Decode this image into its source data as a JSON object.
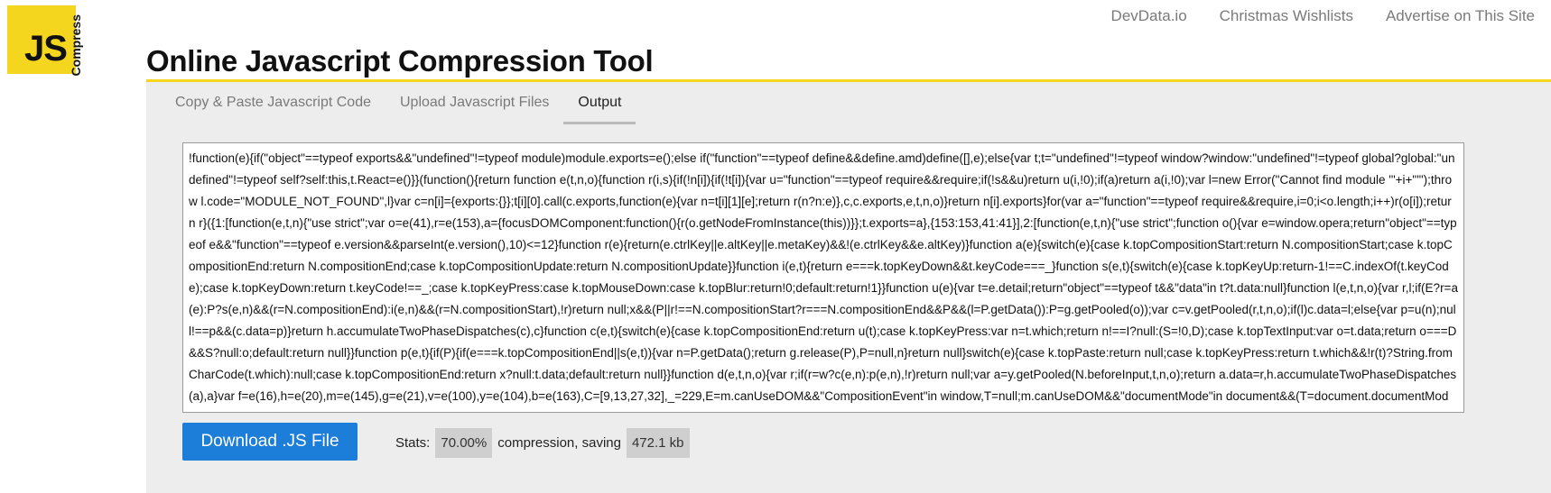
{
  "logo": {
    "main": "JS",
    "side": "Compress"
  },
  "topnav": {
    "links": [
      "DevData.io",
      "Christmas Wishlists",
      "Advertise on This Site"
    ]
  },
  "title": "Online Javascript Compression Tool",
  "tabs": [
    {
      "label": "Copy & Paste Javascript Code",
      "active": false
    },
    {
      "label": "Upload Javascript Files",
      "active": false
    },
    {
      "label": "Output",
      "active": true
    }
  ],
  "output": {
    "code": "!function(e){if(\"object\"==typeof exports&&\"undefined\"!=typeof module)module.exports=e();else if(\"function\"==typeof define&&define.amd)define([],e);else{var t;t=\"undefined\"!=typeof window?window:\"undefined\"!=typeof global?global:\"undefined\"!=typeof self?self:this,t.React=e()}}(function(){return function e(t,n,o){function r(i,s){if(!n[i]){if(!t[i]){var u=\"function\"==typeof require&&require;if(!s&&u)return u(i,!0);if(a)return a(i,!0);var l=new Error(\"Cannot find module '\"+i+\"'\");throw l.code=\"MODULE_NOT_FOUND\",l}var c=n[i]={exports:{}};t[i][0].call(c.exports,function(e){var n=t[i][1][e];return r(n?n:e)},c,c.exports,e,t,n,o)}return n[i].exports}for(var a=\"function\"==typeof require&&require,i=0;i<o.length;i++)r(o[i]);return r}({1:[function(e,t,n){\"use strict\";var o=e(41),r=e(153),a={focusDOMComponent:function(){r(o.getNodeFromInstance(this))}};t.exports=a},{153:153,41:41}],2:[function(e,t,n){\"use strict\";function o(){var e=window.opera;return\"object\"==typeof e&&\"function\"==typeof e.version&&parseInt(e.version(),10)<=12}function r(e){return(e.ctrlKey||e.altKey||e.metaKey)&&!(e.ctrlKey&&e.altKey)}function a(e){switch(e){case k.topCompositionStart:return N.compositionStart;case k.topCompositionEnd:return N.compositionEnd;case k.topCompositionUpdate:return N.compositionUpdate}}function i(e,t){return e===k.topKeyDown&&t.keyCode===_}function s(e,t){switch(e){case k.topKeyUp:return-1!==C.indexOf(t.keyCode);case k.topKeyDown:return t.keyCode!==_;case k.topKeyPress:case k.topMouseDown:case k.topBlur:return!0;default:return!1}}function u(e){var t=e.detail;return\"object\"==typeof t&&\"data\"in t?t.data:null}function l(e,t,n,o){var r,l;if(E?r=a(e):P?s(e,n)&&(r=N.compositionEnd):i(e,n)&&(r=N.compositionStart),!r)return null;x&&(P||r!==N.compositionStart?r===N.compositionEnd&&P&&(l=P.getData()):P=g.getPooled(o));var c=v.getPooled(r,t,n,o);if(l)c.data=l;else{var p=u(n);null!==p&&(c.data=p)}return h.accumulateTwoPhaseDispatches(c),c}function c(e,t){switch(e){case k.topCompositionEnd:return u(t);case k.topKeyPress:var n=t.which;return n!==I?null:(S=!0,D);case k.topTextInput:var o=t.data;return o===D&&S?null:o;default:return null}}function p(e,t){if(P){if(e===k.topCompositionEnd||s(e,t)){var n=P.getData();return g.release(P),P=null,n}return null}switch(e){case k.topPaste:return null;case k.topKeyPress:return t.which&&!r(t)?String.fromCharCode(t.which):null;case k.topCompositionEnd:return x?null:t.data;default:return null}}function d(e,t,n,o){var r;if(r=w?c(e,n):p(e,n),!r)return null;var a=y.getPooled(N.beforeInput,t,n,o);return a.data=r,h.accumulateTwoPhaseDispatches(a),a}var f=e(16),h=e(20),m=e(145),g=e(21),v=e(100),y=e(104),b=e(163),C=[9,13,27,32],_=229,E=m.canUseDOM&&\"CompositionEvent\"in window,T=null;m.canUseDOM&&\"documentMode\"in document&&(T=document.documentMode);var"
  },
  "download_label": "Download .JS File",
  "stats": {
    "label": "Stats:",
    "percent": "70.00%",
    "middle": "compression, saving",
    "saving": "472.1 kb"
  }
}
